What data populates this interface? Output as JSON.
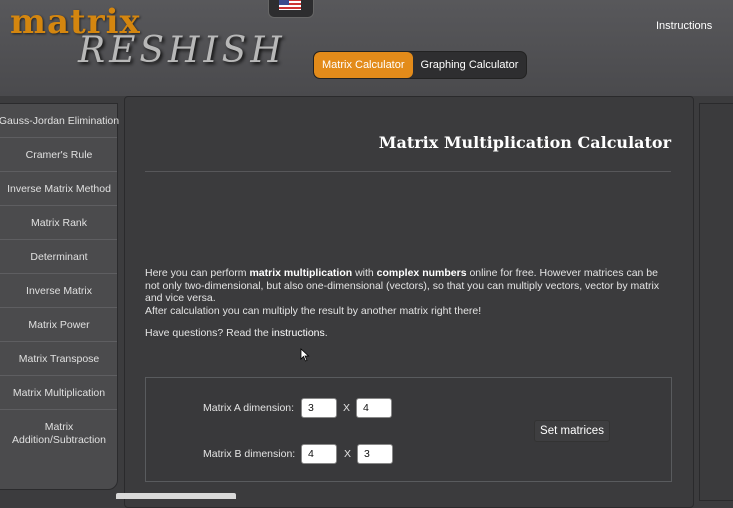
{
  "header": {
    "logo_top": "matrix",
    "logo_bottom": "RESHISH",
    "instructions_link": "Instructions",
    "tabs": [
      {
        "label": "Matrix Calculator",
        "active": true
      },
      {
        "label": "Graphing Calculator",
        "active": false
      }
    ]
  },
  "sidebar": {
    "items": [
      {
        "label": "Gauss-Jordan Elimination"
      },
      {
        "label": "Cramer's Rule"
      },
      {
        "label": "Inverse Matrix Method"
      },
      {
        "label": "Matrix Rank"
      },
      {
        "label": "Determinant"
      },
      {
        "label": "Inverse Matrix"
      },
      {
        "label": "Matrix Power"
      },
      {
        "label": "Matrix Transpose"
      },
      {
        "label": "Matrix Multiplication"
      },
      {
        "label": "Matrix Addition/Subtraction"
      }
    ]
  },
  "main": {
    "title": "Matrix Multiplication Calculator",
    "desc": {
      "p1_a": "Here you can perform ",
      "p1_b": "matrix multiplication",
      "p1_c": " with ",
      "p1_d": "complex numbers",
      "p1_e": " online for free. However matrices can be not only two-dimensional, but also one-dimensional (vectors), so that you can multiply vectors, vector by matrix and vice versa.",
      "p2": "After calculation you can multiply the result by another matrix right there!",
      "q_a": "Have questions? Read the ",
      "q_link": "instructions",
      "q_b": "."
    },
    "matrix_a": {
      "label": "Matrix A dimension:",
      "rows": "3",
      "cols": "4"
    },
    "matrix_b": {
      "label": "Matrix B dimension:",
      "rows": "4",
      "cols": "3"
    },
    "times_symbol": "X",
    "set_button": "Set matrices"
  },
  "colors": {
    "accent": "#e38b1a",
    "logo_orange": "#d4860f",
    "background": "#3c3c3e"
  }
}
